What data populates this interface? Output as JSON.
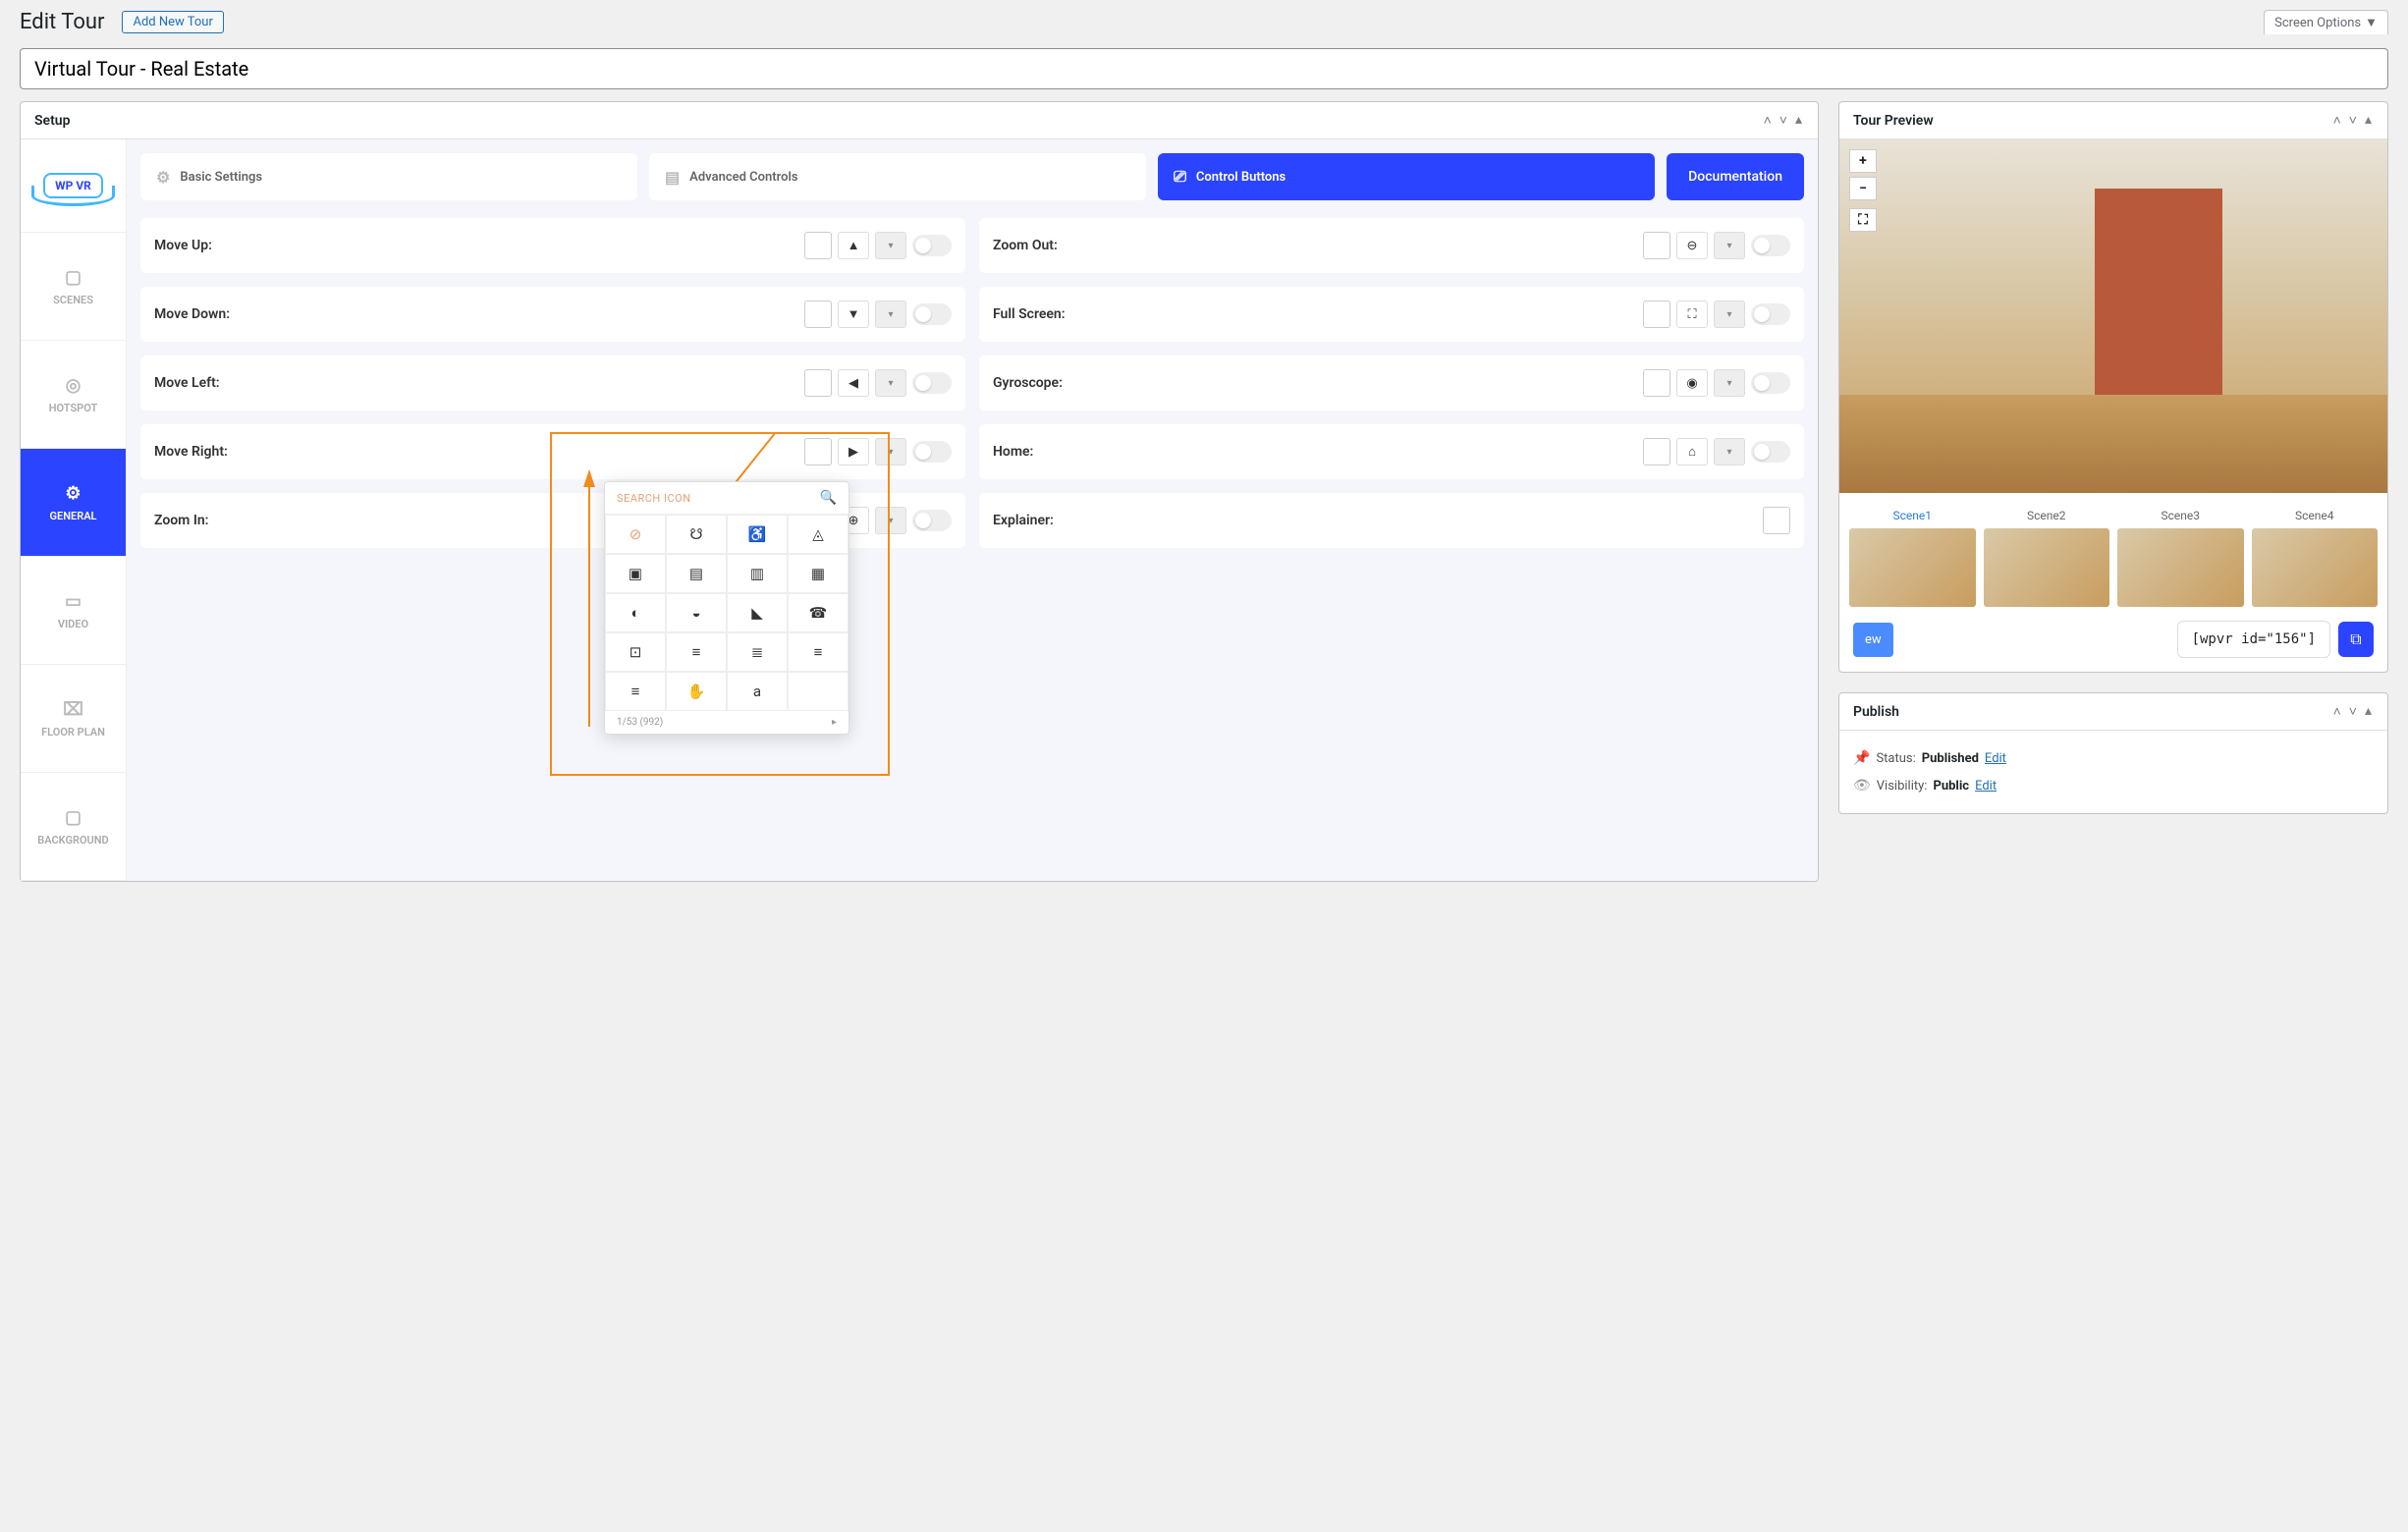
{
  "header": {
    "page_title": "Edit Tour",
    "add_new_label": "Add New Tour",
    "screen_options_label": "Screen Options"
  },
  "tour_title": "Virtual Tour - Real Estate",
  "setup_panel": {
    "title": "Setup",
    "logo_text": "WP VR",
    "side_nav": [
      {
        "label": "SCENES",
        "icon": "▢"
      },
      {
        "label": "HOTSPOT",
        "icon": "◎"
      },
      {
        "label": "GENERAL",
        "icon": "⚙"
      },
      {
        "label": "VIDEO",
        "icon": "▭"
      },
      {
        "label": "FLOOR PLAN",
        "icon": "⌧"
      },
      {
        "label": "BACKGROUND",
        "icon": "▢"
      }
    ],
    "tabs": {
      "basic": "Basic Settings",
      "advanced": "Advanced Controls",
      "control": "Control Buttons",
      "documentation": "Documentation"
    },
    "controls_left": [
      {
        "label": "Move Up:",
        "icon": "▲"
      },
      {
        "label": "Move Down:",
        "icon": "▼"
      },
      {
        "label": "Move Left:",
        "icon": "◀"
      },
      {
        "label": "Move Right:",
        "icon": "▶"
      },
      {
        "label": "Zoom In:",
        "icon": "⊕"
      }
    ],
    "controls_right": [
      {
        "label": "Zoom Out:",
        "icon": "⊖"
      },
      {
        "label": "Full Screen:",
        "icon": "⛶"
      },
      {
        "label": "Gyroscope:",
        "icon": "◉"
      },
      {
        "label": "Home:",
        "icon": "⌂"
      },
      {
        "label": "Explainer:",
        "icon": ""
      }
    ]
  },
  "icon_picker": {
    "search_placeholder": "SEARCH ICON",
    "footer_text": "1/53 (992)",
    "icons": [
      "⊘",
      "☋",
      "♿",
      "◬",
      "▣",
      "▤",
      "▥",
      "▦",
      "◐",
      "◒",
      "◣",
      "☎",
      "⊡",
      "≡",
      "≣",
      "≡",
      "≡",
      "✋",
      "a"
    ]
  },
  "preview_panel": {
    "title": "Tour Preview",
    "zoom_in": "+",
    "zoom_out": "−",
    "fullscreen": "⛶",
    "scenes": [
      "Scene1",
      "Scene2",
      "Scene3",
      "Scene4"
    ],
    "preview_btn": "ew",
    "shortcode": "[wpvr id=\"156\"]"
  },
  "publish_panel": {
    "title": "Publish",
    "status_label": "Status:",
    "status_value": "Published",
    "visibility_label": "Visibility:",
    "visibility_value": "Public",
    "edit_label": "Edit"
  }
}
